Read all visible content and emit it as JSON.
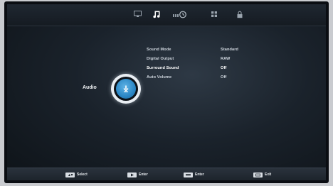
{
  "tabs": [
    {
      "name": "picture",
      "icon": "monitor-icon"
    },
    {
      "name": "audio",
      "icon": "music-note-icon",
      "active": true
    },
    {
      "name": "time",
      "icon": "clock-icon"
    },
    {
      "name": "setup",
      "icon": "grid-icon"
    },
    {
      "name": "lock",
      "icon": "padlock-icon"
    }
  ],
  "section": {
    "label": "Audio",
    "icon": "audio-disc-icon"
  },
  "settings": [
    {
      "label": "Sound Mode",
      "value": "Standard"
    },
    {
      "label": "Digital Output",
      "value": "RAW"
    },
    {
      "label": "Surround Sound",
      "value": "Off",
      "selected": true
    },
    {
      "label": "Auto Volume",
      "value": "Off"
    }
  ],
  "hints": [
    {
      "label": "Select",
      "icon": "updown-key-icon"
    },
    {
      "label": "Enter",
      "icon": "ok-key-icon"
    },
    {
      "label": "Enter",
      "icon": "menu-key-icon"
    },
    {
      "label": "Exit",
      "icon": "exit-key-icon"
    }
  ],
  "colors": {
    "accent": "#2a86c4",
    "text": "#cfd6de",
    "background": "#161d25"
  }
}
